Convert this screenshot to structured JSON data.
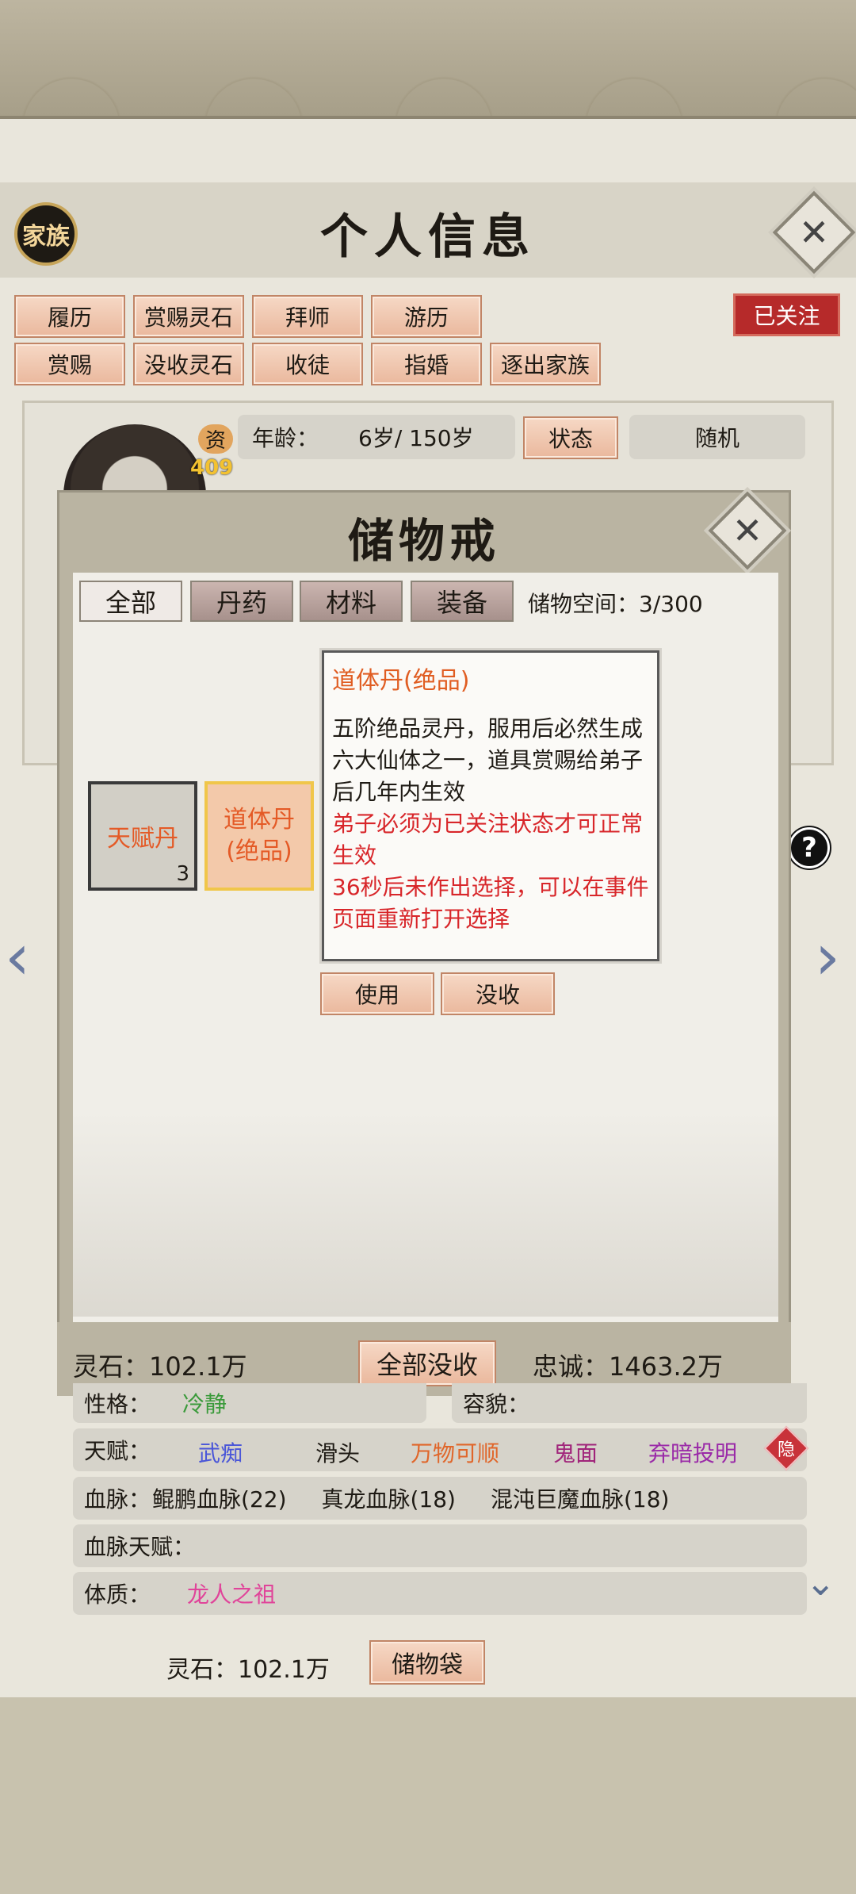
{
  "header": {
    "family_label": "家族",
    "title": "个人信息"
  },
  "actions_row1": [
    "履历",
    "赏赐灵石",
    "拜师",
    "游历"
  ],
  "actions_row2": [
    "赏赐",
    "没收灵石",
    "收徒",
    "指婚",
    "逐出家族"
  ],
  "follow_status": "已关注",
  "profile": {
    "zi_label": "资",
    "zi_value": "409",
    "age_label": "年龄：",
    "age_value": "6岁/ 150岁",
    "status_button": "状态",
    "random_button": "随机"
  },
  "storage_ring": {
    "title": "储物戒",
    "tabs": [
      "全部",
      "丹药",
      "材料",
      "装备"
    ],
    "active_tab": "全部",
    "space_label": "储物空间：3/300",
    "items": [
      {
        "name": "天赋丹",
        "count": "3"
      },
      {
        "name": "道体丹\n(绝品)",
        "count": ""
      }
    ],
    "tooltip": {
      "title": "道体丹(绝品)",
      "description": "五阶绝品灵丹，服用后必然生成六大仙体之一，道具赏赐给弟子后几年内生效",
      "warning1": "弟子必须为已关注状态才可正常生效",
      "warning2": "36秒后未作出选择，可以在事件页面重新打开选择"
    },
    "use_button": "使用",
    "confiscate_button": "没收",
    "spirit_stone": "灵石：102.1万",
    "confiscate_all_button": "全部没收",
    "loyalty": "忠诚：1463.2万"
  },
  "traits": {
    "personality_label": "性格：",
    "personality_value": "冷静",
    "appearance_label": "容貌：",
    "talent_label": "天赋：",
    "talents": [
      {
        "name": "武痴",
        "color": "#4a56d8"
      },
      {
        "name": "滑头",
        "color": "#1e1a14"
      },
      {
        "name": "万物可顺",
        "color": "#e0662a"
      },
      {
        "name": "鬼面",
        "color": "#a0247a"
      },
      {
        "name": "弃暗投明",
        "color": "#9a2aa8"
      }
    ],
    "hide_label": "隐",
    "bloodline_label": "血脉：",
    "bloodlines": [
      "鲲鹏血脉(22)",
      "真龙血脉(18)",
      "混沌巨魔血脉(18)"
    ],
    "bloodline_talent_label": "血脉天赋：",
    "physique_label": "体质：",
    "physique_value": "龙人之祖"
  },
  "footer": {
    "spirit_stone": "灵石：102.1万",
    "storage_bag_button": "储物袋"
  },
  "colors": {
    "button_fill": "#eab89d",
    "follow_red": "#b62a2a",
    "item_orange": "#e45a26",
    "warning_red": "#d8262a"
  }
}
